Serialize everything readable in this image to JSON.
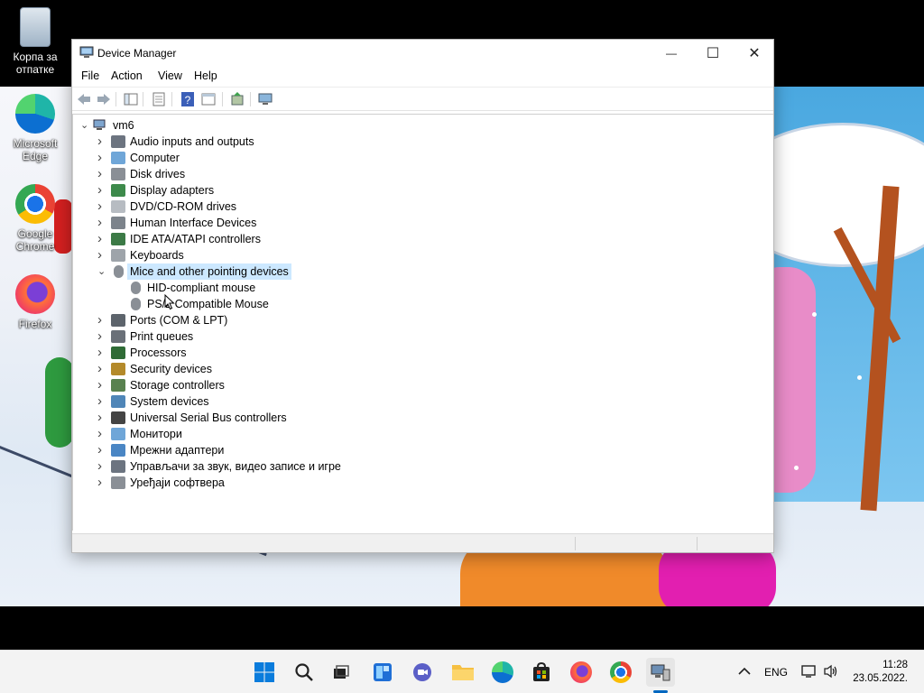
{
  "desktop": {
    "icons": [
      {
        "label": "Корпа за отпатке",
        "icon": "recycle-bin-icon"
      },
      {
        "label": "Microsoft Edge",
        "icon": "edge-icon"
      },
      {
        "label": "Google Chrome",
        "icon": "chrome-icon"
      },
      {
        "label": "Firefox",
        "icon": "firefox-icon"
      }
    ]
  },
  "window": {
    "title": "Device Manager",
    "menu": [
      "File",
      "Action",
      "View",
      "Help"
    ],
    "controls": {
      "minimize": "—",
      "maximize": "☐",
      "close": "✕"
    }
  },
  "tree": {
    "root": "vm6",
    "categories": [
      {
        "label": "Audio inputs and outputs",
        "icon": "speaker-icon",
        "expanded": false
      },
      {
        "label": "Computer",
        "icon": "monitor-icon",
        "expanded": false
      },
      {
        "label": "Disk drives",
        "icon": "disk-icon",
        "expanded": false
      },
      {
        "label": "Display adapters",
        "icon": "display-adapter-icon",
        "expanded": false
      },
      {
        "label": "DVD/CD-ROM drives",
        "icon": "dvd-icon",
        "expanded": false
      },
      {
        "label": "Human Interface Devices",
        "icon": "hid-icon",
        "expanded": false
      },
      {
        "label": "IDE ATA/ATAPI controllers",
        "icon": "ide-icon",
        "expanded": false
      },
      {
        "label": "Keyboards",
        "icon": "keyboard-icon",
        "expanded": false
      },
      {
        "label": "Mice and other pointing devices",
        "icon": "mouse-icon",
        "expanded": true,
        "selected": true,
        "children": [
          "HID-compliant mouse",
          "PS/2 Compatible Mouse"
        ]
      },
      {
        "label": "Ports (COM & LPT)",
        "icon": "port-icon",
        "expanded": false
      },
      {
        "label": "Print queues",
        "icon": "printer-icon",
        "expanded": false
      },
      {
        "label": "Processors",
        "icon": "processor-icon",
        "expanded": false
      },
      {
        "label": "Security devices",
        "icon": "security-icon",
        "expanded": false
      },
      {
        "label": "Storage controllers",
        "icon": "storage-icon",
        "expanded": false
      },
      {
        "label": "System devices",
        "icon": "system-icon",
        "expanded": false
      },
      {
        "label": "Universal Serial Bus controllers",
        "icon": "usb-icon",
        "expanded": false
      },
      {
        "label": "Монитори",
        "icon": "monitor-icon",
        "expanded": false
      },
      {
        "label": "Мрежни адаптери",
        "icon": "network-icon",
        "expanded": false
      },
      {
        "label": "Управљачи за звук, видео записе и игре",
        "icon": "speaker-icon",
        "expanded": false
      },
      {
        "label": "Уређаји софтвера",
        "icon": "software-device-icon",
        "expanded": false
      }
    ]
  },
  "taskbar": {
    "apps": [
      "start-icon",
      "search-icon",
      "task-view-icon",
      "widgets-icon",
      "chat-icon",
      "file-explorer-icon",
      "edge-icon",
      "store-icon",
      "firefox-icon",
      "chrome-icon",
      "device-manager-icon"
    ],
    "language": "ENG",
    "time": "11:28",
    "date": "23.05.2022."
  }
}
